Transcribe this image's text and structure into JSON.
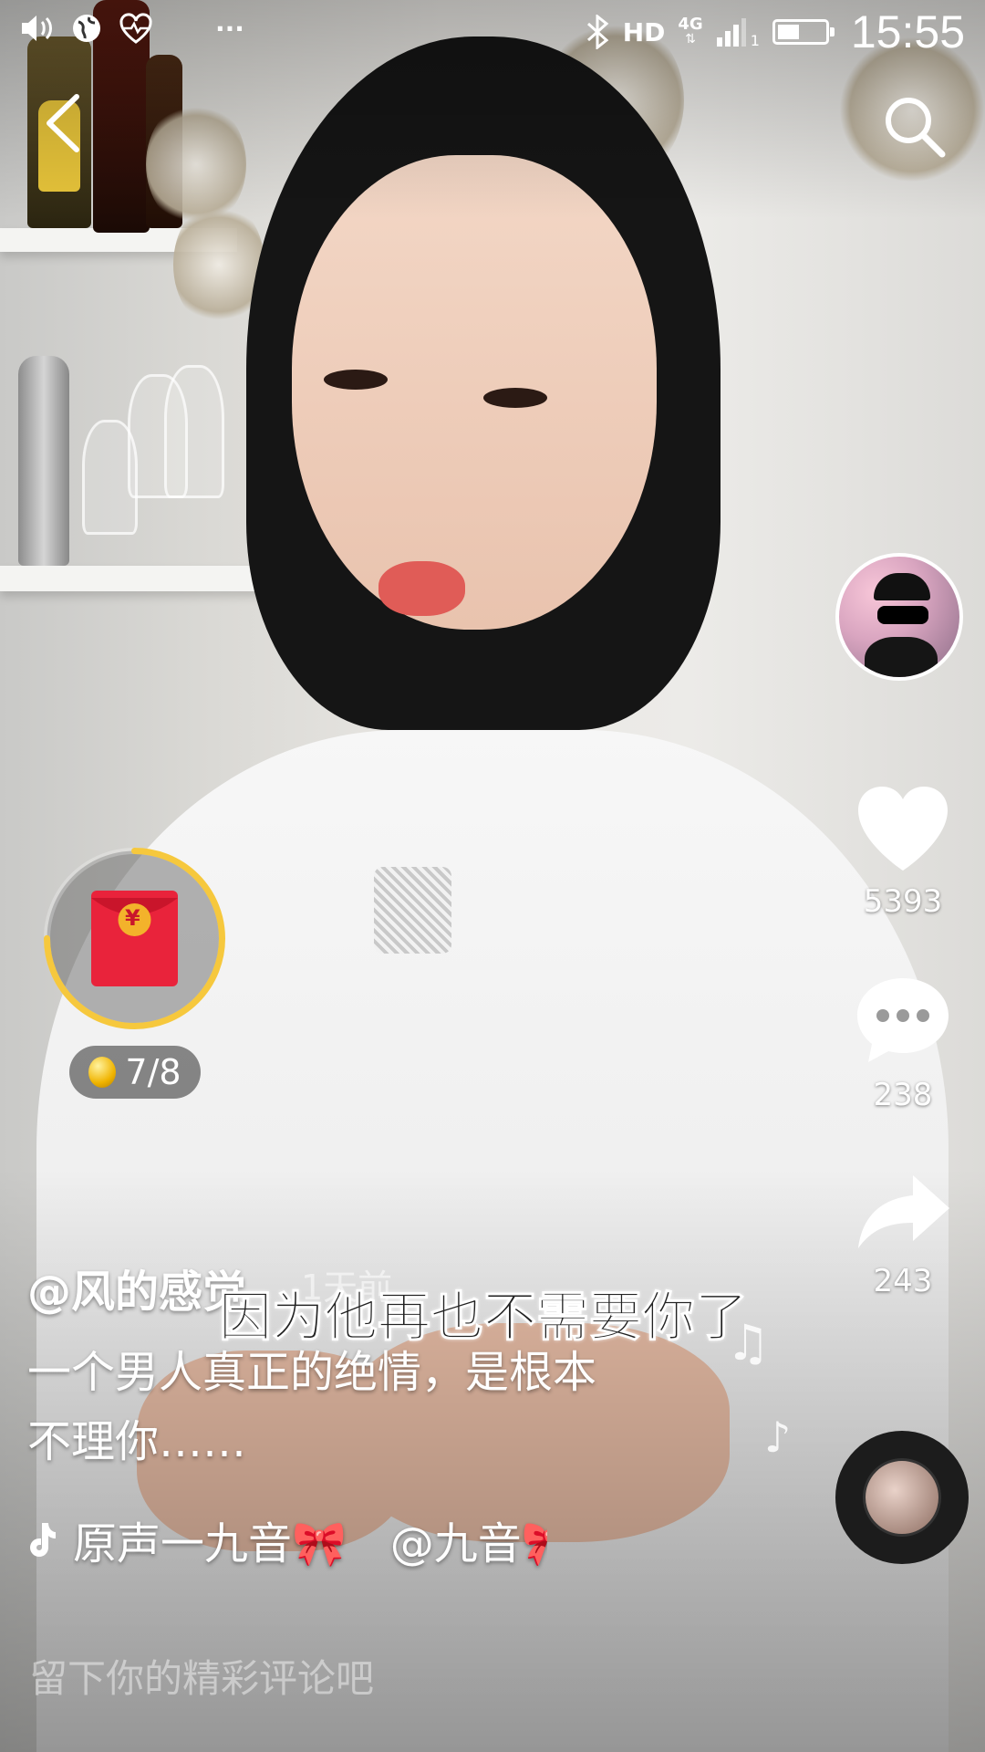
{
  "status_bar": {
    "network": "HD",
    "signal_type": "4G",
    "sim_index": "1",
    "time": "15:55",
    "overflow": "···",
    "battery_level": 0.45,
    "icons": [
      "speaker-icon",
      "globe-icon",
      "heart-monitor-icon",
      "bluetooth-icon",
      "signal-icon",
      "battery-icon"
    ]
  },
  "top_bar": {
    "back_icon": "chevron-left-icon",
    "search_icon": "search-icon"
  },
  "actions": {
    "like_count": "5393",
    "comment_count": "238",
    "share_count": "243"
  },
  "reward": {
    "progress_text": "7/8",
    "ring_progress": 0.75,
    "packet_symbol": "¥"
  },
  "video_overlay": {
    "subtitle": "因为他再也不需要你了",
    "faint_text": "1天前"
  },
  "post": {
    "author": "@风的感觉",
    "description_line1": "一个男人真正的绝情，是根本",
    "description_line2": "不理你……",
    "music_text": "原声一九音🎀　@九音🎀"
  },
  "comment_box": {
    "placeholder": "留下你的精彩评论吧"
  },
  "colors": {
    "ring": "#f6c83d",
    "packet_red": "#e9233b",
    "packet_gold": "#f3b22b"
  }
}
